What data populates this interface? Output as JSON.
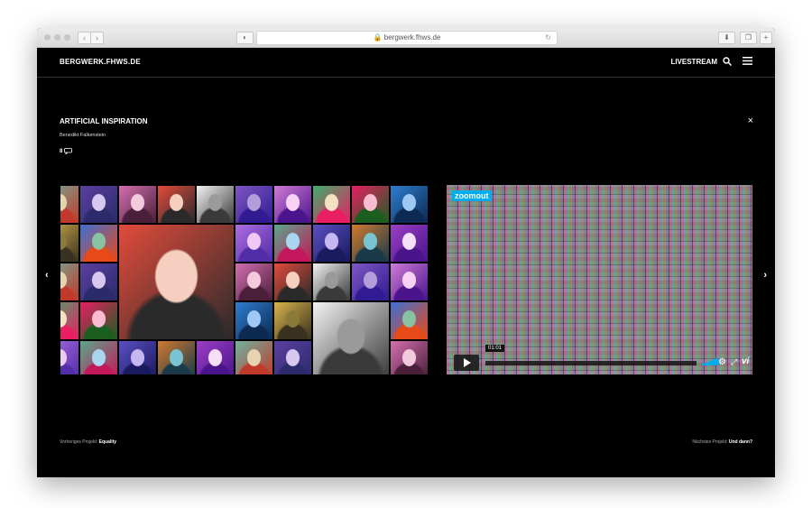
{
  "browser": {
    "url": "bergwerk.fhws.de"
  },
  "header": {
    "brand": "BERGWERK.FHWS.DE",
    "livestream_label": "LIVESTREAM"
  },
  "project": {
    "title": "ARTIFICIAL INSPIRATION",
    "author": "Benedikt Falkenstein",
    "comment_count": "8",
    "close_label": "×"
  },
  "gallery": {
    "prev_arrow": "‹",
    "next_arrow": "›"
  },
  "video": {
    "badge": "zoomout",
    "time": "01:01",
    "vimeo_label": "vi",
    "accent": "#00adef"
  },
  "footer": {
    "prev_caption": "Vorheriges Projekt:",
    "prev_title": "Equality",
    "next_caption": "Nächstes Projekt:",
    "next_title": "Und dann?"
  }
}
